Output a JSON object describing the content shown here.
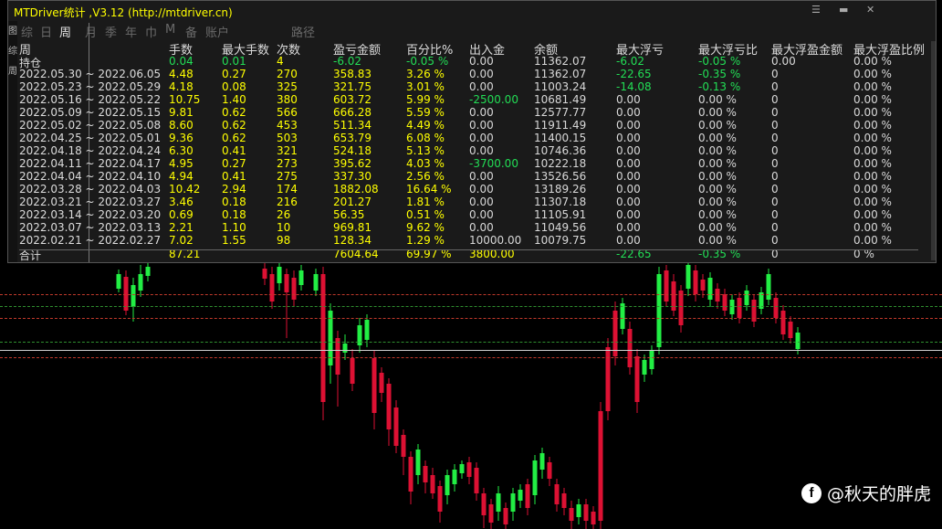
{
  "window": {
    "title": "MTDriver统计 ,V3.12 (http://mtdriver.cn)"
  },
  "left_strip": [
    "图",
    "综",
    "周"
  ],
  "tabs": [
    {
      "label": "综",
      "active": false
    },
    {
      "label": "日",
      "active": false
    },
    {
      "label": "周",
      "active": true
    },
    {
      "label": "月",
      "active": false
    },
    {
      "label": "季",
      "active": false
    },
    {
      "label": "年",
      "active": false
    },
    {
      "label": "巾",
      "active": false
    },
    {
      "label": "M",
      "active": false
    },
    {
      "label": "备",
      "active": false
    },
    {
      "label": "账户",
      "active": false
    },
    {
      "label": "路径",
      "active": false
    }
  ],
  "table": {
    "headers": [
      "周",
      "手数",
      "最大手数",
      "次数",
      "盈亏金额",
      "百分比%",
      "出入金",
      "余额",
      "最大浮亏",
      "最大浮亏比",
      "最大浮盈金额",
      "最大浮盈比例"
    ],
    "rows": [
      {
        "period": "持仓",
        "lots": "0.04",
        "max_lots": "0.01",
        "count": "4",
        "pnl": "-6.02",
        "pct": "-0.05 %",
        "flow": "0.00",
        "balance": "11362.07",
        "max_dd": "-6.02",
        "max_dd_pct": "-0.05 %",
        "max_fp": "0.00",
        "max_fp_pct": "0.00 %"
      },
      {
        "period": "2022.05.30 ~ 2022.06.05",
        "lots": "4.48",
        "max_lots": "0.27",
        "count": "270",
        "pnl": "358.83",
        "pct": "3.26 %",
        "flow": "0.00",
        "balance": "11362.07",
        "max_dd": "-22.65",
        "max_dd_pct": "-0.35 %",
        "max_fp": "0",
        "max_fp_pct": "0.00 %"
      },
      {
        "period": "2022.05.23 ~ 2022.05.29",
        "lots": "4.18",
        "max_lots": "0.08",
        "count": "325",
        "pnl": "321.75",
        "pct": "3.01 %",
        "flow": "0.00",
        "balance": "11003.24",
        "max_dd": "-14.08",
        "max_dd_pct": "-0.13 %",
        "max_fp": "0",
        "max_fp_pct": "0.00 %"
      },
      {
        "period": "2022.05.16 ~ 2022.05.22",
        "lots": "10.75",
        "max_lots": "1.40",
        "count": "380",
        "pnl": "603.72",
        "pct": "5.99 %",
        "flow": "-2500.00",
        "balance": "10681.49",
        "max_dd": "0.00",
        "max_dd_pct": "0.00 %",
        "max_fp": "0",
        "max_fp_pct": "0.00 %"
      },
      {
        "period": "2022.05.09 ~ 2022.05.15",
        "lots": "9.81",
        "max_lots": "0.62",
        "count": "566",
        "pnl": "666.28",
        "pct": "5.59 %",
        "flow": "0.00",
        "balance": "12577.77",
        "max_dd": "0.00",
        "max_dd_pct": "0.00 %",
        "max_fp": "0",
        "max_fp_pct": "0.00 %"
      },
      {
        "period": "2022.05.02 ~ 2022.05.08",
        "lots": "8.60",
        "max_lots": "0.62",
        "count": "453",
        "pnl": "511.34",
        "pct": "4.49 %",
        "flow": "0.00",
        "balance": "11911.49",
        "max_dd": "0.00",
        "max_dd_pct": "0.00 %",
        "max_fp": "0",
        "max_fp_pct": "0.00 %"
      },
      {
        "period": "2022.04.25 ~ 2022.05.01",
        "lots": "9.36",
        "max_lots": "0.62",
        "count": "503",
        "pnl": "653.79",
        "pct": "6.08 %",
        "flow": "0.00",
        "balance": "11400.15",
        "max_dd": "0.00",
        "max_dd_pct": "0.00 %",
        "max_fp": "0",
        "max_fp_pct": "0.00 %"
      },
      {
        "period": "2022.04.18 ~ 2022.04.24",
        "lots": "6.30",
        "max_lots": "0.41",
        "count": "321",
        "pnl": "524.18",
        "pct": "5.13 %",
        "flow": "0.00",
        "balance": "10746.36",
        "max_dd": "0.00",
        "max_dd_pct": "0.00 %",
        "max_fp": "0",
        "max_fp_pct": "0.00 %"
      },
      {
        "period": "2022.04.11 ~ 2022.04.17",
        "lots": "4.95",
        "max_lots": "0.27",
        "count": "273",
        "pnl": "395.62",
        "pct": "4.03 %",
        "flow": "-3700.00",
        "balance": "10222.18",
        "max_dd": "0.00",
        "max_dd_pct": "0.00 %",
        "max_fp": "0",
        "max_fp_pct": "0.00 %"
      },
      {
        "period": "2022.04.04 ~ 2022.04.10",
        "lots": "4.94",
        "max_lots": "0.41",
        "count": "275",
        "pnl": "337.30",
        "pct": "2.56 %",
        "flow": "0.00",
        "balance": "13526.56",
        "max_dd": "0.00",
        "max_dd_pct": "0.00 %",
        "max_fp": "0",
        "max_fp_pct": "0.00 %"
      },
      {
        "period": "2022.03.28 ~ 2022.04.03",
        "lots": "10.42",
        "max_lots": "2.94",
        "count": "174",
        "pnl": "1882.08",
        "pct": "16.64 %",
        "flow": "0.00",
        "balance": "13189.26",
        "max_dd": "0.00",
        "max_dd_pct": "0.00 %",
        "max_fp": "0",
        "max_fp_pct": "0.00 %"
      },
      {
        "period": "2022.03.21 ~ 2022.03.27",
        "lots": "3.46",
        "max_lots": "0.18",
        "count": "216",
        "pnl": "201.27",
        "pct": "1.81 %",
        "flow": "0.00",
        "balance": "11307.18",
        "max_dd": "0.00",
        "max_dd_pct": "0.00 %",
        "max_fp": "0",
        "max_fp_pct": "0.00 %"
      },
      {
        "period": "2022.03.14 ~ 2022.03.20",
        "lots": "0.69",
        "max_lots": "0.18",
        "count": "26",
        "pnl": "56.35",
        "pct": "0.51 %",
        "flow": "0.00",
        "balance": "11105.91",
        "max_dd": "0.00",
        "max_dd_pct": "0.00 %",
        "max_fp": "0",
        "max_fp_pct": "0.00 %"
      },
      {
        "period": "2022.03.07 ~ 2022.03.13",
        "lots": "2.21",
        "max_lots": "1.10",
        "count": "10",
        "pnl": "969.81",
        "pct": "9.62 %",
        "flow": "0.00",
        "balance": "11049.56",
        "max_dd": "0.00",
        "max_dd_pct": "0.00 %",
        "max_fp": "0",
        "max_fp_pct": "0.00 %"
      },
      {
        "period": "2022.02.21 ~ 2022.02.27",
        "lots": "7.02",
        "max_lots": "1.55",
        "count": "98",
        "pnl": "128.34",
        "pct": "1.29 %",
        "flow": "10000.00",
        "balance": "10079.75",
        "max_dd": "0.00",
        "max_dd_pct": "0.00 %",
        "max_fp": "0",
        "max_fp_pct": "0.00 %"
      }
    ],
    "total": {
      "period": "合计",
      "lots": "87.21",
      "pnl": "7604.64",
      "pct": "69.97 %",
      "flow": "3800.00",
      "max_dd": "-22.65",
      "max_dd_pct": "-0.35 %",
      "max_fp": "0",
      "max_fp_pct": "0 %"
    }
  },
  "watermark": {
    "icon": "f",
    "text": "@秋天的胖虎"
  },
  "colors": {
    "bull": "#22ee44",
    "bear": "#dd1133",
    "text_yellow": "#ffff00",
    "text_green": "#22dd55"
  }
}
